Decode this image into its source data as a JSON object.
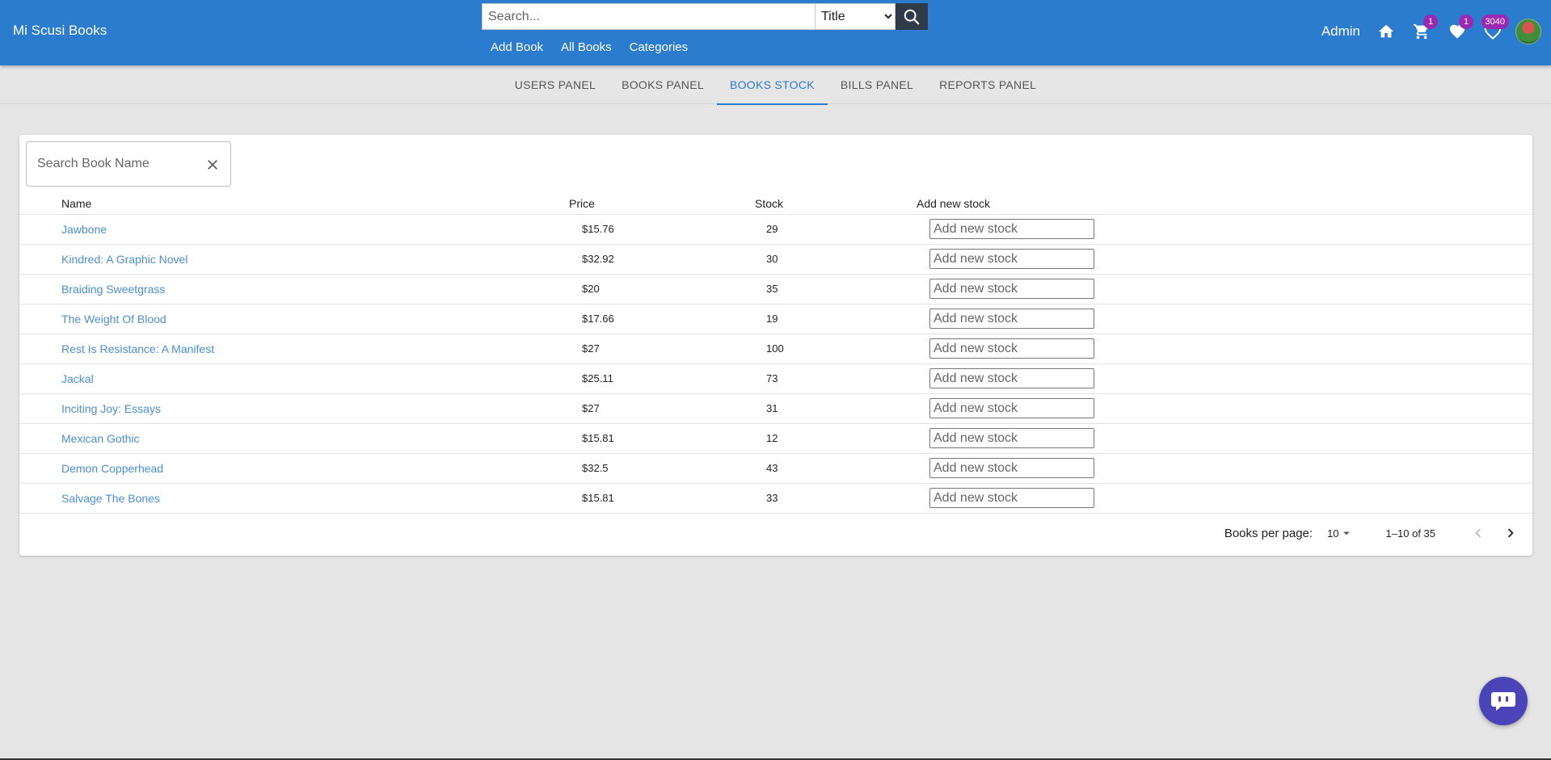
{
  "header": {
    "brand": "Mi Scusi Books",
    "search": {
      "placeholder": "Search...",
      "type_selected": "Title"
    },
    "nav": [
      "Add Book",
      "All Books",
      "Categories"
    ],
    "user_label": "Admin",
    "badges": {
      "cart": "1",
      "wishlist": "1",
      "orders": "3040"
    }
  },
  "tabs": [
    {
      "label": "USERS PANEL"
    },
    {
      "label": "BOOKS PANEL"
    },
    {
      "label": "BOOKS STOCK",
      "active": true
    },
    {
      "label": "BILLS PANEL"
    },
    {
      "label": "REPORTS PANEL"
    }
  ],
  "stock_table": {
    "filter_placeholder": "Search Book Name",
    "columns": [
      "Name",
      "Price",
      "Stock",
      "Add new stock"
    ],
    "input_placeholder": "Add new stock",
    "rows": [
      {
        "name": "Jawbone",
        "price": "$15.76",
        "stock": "29"
      },
      {
        "name": "Kindred: A Graphic Novel",
        "price": "$32.92",
        "stock": "30"
      },
      {
        "name": "Braiding Sweetgrass",
        "price": "$20",
        "stock": "35"
      },
      {
        "name": "The Weight Of Blood",
        "price": "$17.66",
        "stock": "19"
      },
      {
        "name": "Rest Is Resistance: A Manifest",
        "price": "$27",
        "stock": "100"
      },
      {
        "name": "Jackal",
        "price": "$25.11",
        "stock": "73"
      },
      {
        "name": "Inciting Joy: Essays",
        "price": "$27",
        "stock": "31"
      },
      {
        "name": "Mexican Gothic",
        "price": "$15.81",
        "stock": "12"
      },
      {
        "name": "Demon Copperhead",
        "price": "$32.5",
        "stock": "43"
      },
      {
        "name": "Salvage The Bones",
        "price": "$15.81",
        "stock": "33"
      }
    ],
    "pagination": {
      "per_page_label": "Books per page:",
      "per_page": "10",
      "range": "1–10 of 35"
    }
  },
  "colors": {
    "appbar": "#2b7bce",
    "accent": "#2b7bce",
    "badge": "#9c27b0",
    "chat": "#4b43b8"
  }
}
